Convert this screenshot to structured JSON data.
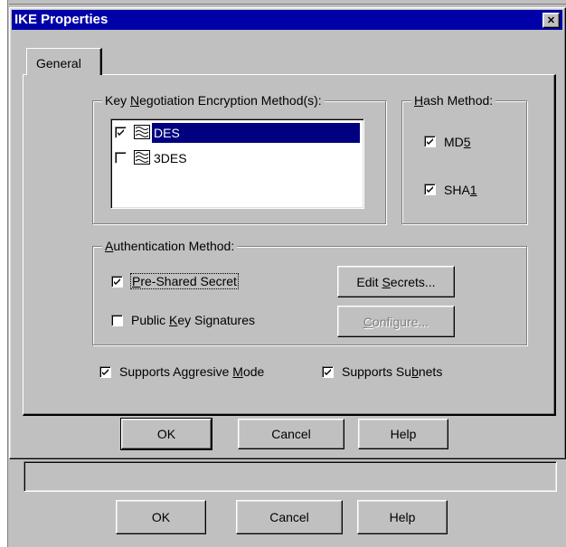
{
  "window": {
    "title": "IKE Properties",
    "close_glyph": "✕"
  },
  "tabs": [
    {
      "label": "General",
      "selected": true
    }
  ],
  "encryption_group": {
    "label_pre": "Key ",
    "label_ul": "N",
    "label_post": "egotiation Encryption Method(s):",
    "items": [
      {
        "label": "DES",
        "checked": true,
        "selected": true,
        "icon": "encryption-icon"
      },
      {
        "label": "3DES",
        "checked": false,
        "selected": false,
        "icon": "encryption-icon"
      }
    ]
  },
  "hash_group": {
    "label_ul": "H",
    "label_post": "ash Method:",
    "items": [
      {
        "pre": "MD",
        "ul": "5",
        "checked": true
      },
      {
        "pre": "SHA",
        "ul": "1",
        "checked": true
      }
    ]
  },
  "auth_group": {
    "label_ul": "A",
    "label_post": "uthentication Method:",
    "pre_shared": {
      "ul": "P",
      "post": "re-Shared Secret",
      "checked": true
    },
    "public_key": {
      "pre": "Public ",
      "ul": "K",
      "post": "ey Signatures",
      "checked": false
    },
    "edit_secrets": {
      "pre": "Edit ",
      "ul": "S",
      "post": "ecrets..."
    },
    "configure": {
      "ul": "C",
      "post": "onfigure...",
      "disabled": true
    }
  },
  "options": {
    "aggressive": {
      "pre": "Supports Aggresive ",
      "ul": "M",
      "post": "ode",
      "checked": true
    },
    "subnets": {
      "pre": "Supports Su",
      "ul": "b",
      "post": "nets",
      "checked": true
    }
  },
  "buttons": {
    "ok": "OK",
    "cancel": "Cancel",
    "help": "Help"
  },
  "background_buttons": {
    "ok": "OK",
    "cancel": "Cancel",
    "help": "Help"
  },
  "colors": {
    "titlebar": "#0000a8",
    "face": "#c0c0c0",
    "selection": "#000080"
  }
}
